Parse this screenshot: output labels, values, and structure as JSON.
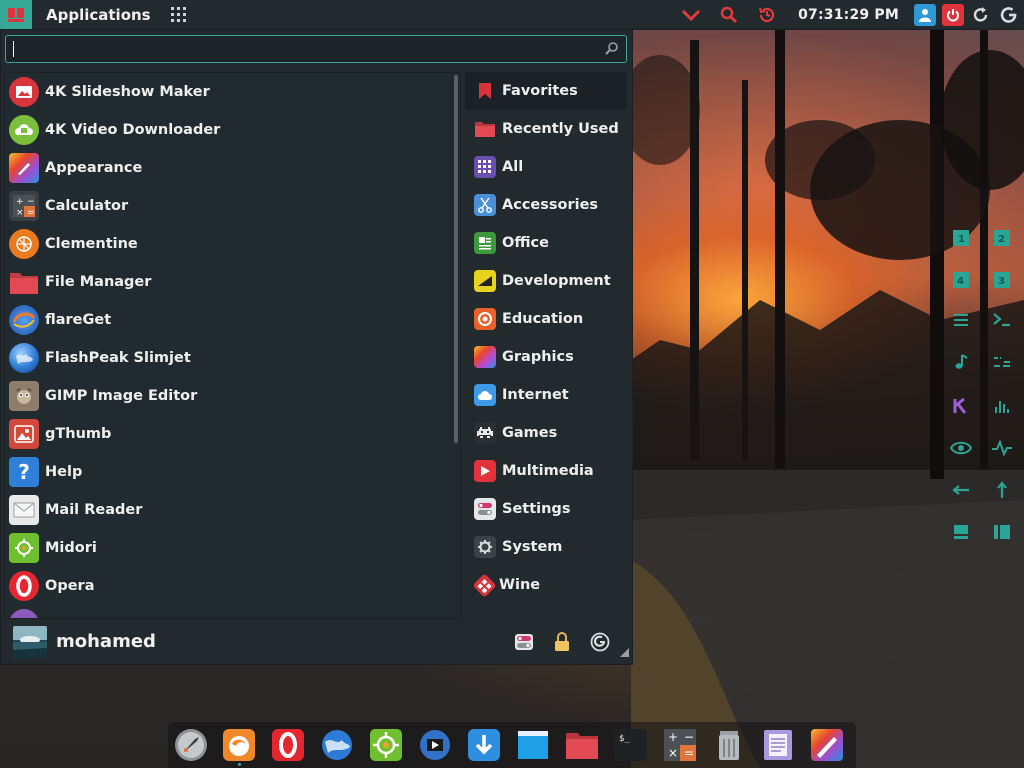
{
  "panel": {
    "menu_label": "Applications",
    "clock": "07:31:29 PM"
  },
  "search": {
    "value": "",
    "placeholder": ""
  },
  "apps": [
    {
      "label": "4K Slideshow Maker",
      "icon": "slideshow-icon",
      "color": "#d9343c"
    },
    {
      "label": "4K Video Downloader",
      "icon": "video-download-icon",
      "color": "#7bbf3a"
    },
    {
      "label": "Appearance",
      "icon": "appearance-brush-icon",
      "color": "#9b4fd0"
    },
    {
      "label": "Calculator",
      "icon": "calculator-icon",
      "color": "#3a3f42"
    },
    {
      "label": "Clementine",
      "icon": "clementine-icon",
      "color": "#e97a1e"
    },
    {
      "label": "File Manager",
      "icon": "folder-icon",
      "color": "#d9444c"
    },
    {
      "label": "flareGet",
      "icon": "flareget-icon",
      "color": "#2a66c8"
    },
    {
      "label": "FlashPeak Slimjet",
      "icon": "slimjet-globe-icon",
      "color": "#2d7bd6"
    },
    {
      "label": "GIMP Image Editor",
      "icon": "gimp-icon",
      "color": "#8d7d6a"
    },
    {
      "label": "gThumb",
      "icon": "gthumb-icon",
      "color": "#d2493c"
    },
    {
      "label": "Help",
      "icon": "help-icon",
      "color": "#2f80d8"
    },
    {
      "label": "Mail Reader",
      "icon": "mail-icon",
      "color": "#e9e9e9"
    },
    {
      "label": "Midori",
      "icon": "midori-icon",
      "color": "#6fbf2e"
    },
    {
      "label": "Opera",
      "icon": "opera-icon",
      "color": "#e3262f"
    }
  ],
  "categories": [
    {
      "label": "Favorites",
      "icon": "bookmark-icon",
      "color": "#d9343c"
    },
    {
      "label": "Recently Used",
      "icon": "recent-folder-icon",
      "color": "#d9444c"
    },
    {
      "label": "All",
      "icon": "all-grid-icon",
      "color": "#6a4fae"
    },
    {
      "label": "Accessories",
      "icon": "scissors-icon",
      "color": "#4a8fd8"
    },
    {
      "label": "Office",
      "icon": "office-icon",
      "color": "#3c9a3c"
    },
    {
      "label": "Development",
      "icon": "development-icon",
      "color": "#e8d21e"
    },
    {
      "label": "Education",
      "icon": "education-icon",
      "color": "#e8602a"
    },
    {
      "label": "Graphics",
      "icon": "graphics-icon",
      "color": "#b84bd4"
    },
    {
      "label": "Internet",
      "icon": "cloud-icon",
      "color": "#3d9ae8"
    },
    {
      "label": "Games",
      "icon": "gamepad-icon",
      "color": "#2a2f33"
    },
    {
      "label": "Multimedia",
      "icon": "play-icon",
      "color": "#e2323a"
    },
    {
      "label": "Settings",
      "icon": "settings-toggle-icon",
      "color": "#e5e7ea"
    },
    {
      "label": "System",
      "icon": "gear-icon",
      "color": "#3a4147"
    },
    {
      "label": "Wine",
      "icon": "wine-icon",
      "color": "#d8343c"
    }
  ],
  "user": {
    "name": "mohamed"
  },
  "widgets": [
    {
      "name": "workspace-1-icon",
      "glyph": "1"
    },
    {
      "name": "workspace-2-icon",
      "glyph": "2"
    },
    {
      "name": "workspace-4-icon",
      "glyph": "4"
    },
    {
      "name": "workspace-3-icon",
      "glyph": "3"
    }
  ],
  "colors": {
    "accent": "#37a896",
    "panel_bg": "#232a2e",
    "menu_bg": "#222a2e",
    "text": "#eef0f0"
  },
  "dock": [
    {
      "name": "dock-launcher-icon"
    },
    {
      "name": "dock-firefox-icon"
    },
    {
      "name": "dock-opera-icon"
    },
    {
      "name": "dock-slimjet-icon"
    },
    {
      "name": "dock-midori-icon"
    },
    {
      "name": "dock-video-player-icon"
    },
    {
      "name": "dock-downloader-icon"
    },
    {
      "name": "dock-desktop-icon"
    },
    {
      "name": "dock-folder-icon"
    },
    {
      "name": "dock-terminal-icon"
    },
    {
      "name": "dock-calculator-icon"
    },
    {
      "name": "dock-trash-icon"
    },
    {
      "name": "dock-text-editor-icon"
    },
    {
      "name": "dock-appearance-icon"
    }
  ]
}
